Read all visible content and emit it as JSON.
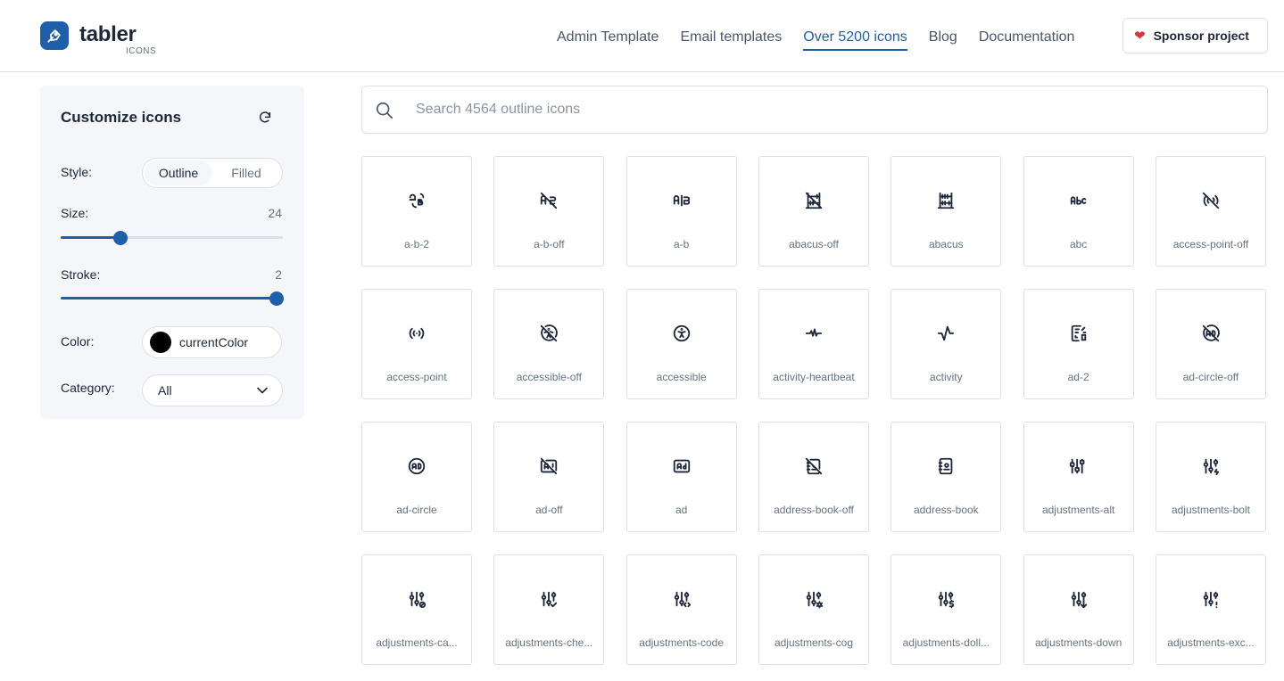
{
  "brand": {
    "name": "tabler",
    "sub": "ICONS"
  },
  "nav": {
    "items": [
      {
        "label": "Admin Template"
      },
      {
        "label": "Email templates"
      },
      {
        "label": "Over 5200 icons"
      },
      {
        "label": "Blog"
      },
      {
        "label": "Documentation"
      }
    ],
    "active_index": 2
  },
  "sponsor": {
    "label": "Sponsor project",
    "icon": "heart-icon",
    "color": "#d63939"
  },
  "customize": {
    "title": "Customize icons",
    "style_label": "Style:",
    "style_options": [
      "Outline",
      "Filled"
    ],
    "style_selected": "Outline",
    "size_label": "Size:",
    "size_value": "24",
    "size_fraction": 0.27,
    "stroke_label": "Stroke:",
    "stroke_value": "2",
    "stroke_fraction": 0.97,
    "color_label": "Color:",
    "color_value": "currentColor",
    "color_swatch": "#000000",
    "category_label": "Category:",
    "category_value": "All"
  },
  "search": {
    "placeholder": "Search 4564 outline icons"
  },
  "theme": {
    "accent": "#1f5ea8",
    "text": "#1d273b",
    "muted": "#667382",
    "border": "#dce1e7"
  },
  "icons": [
    {
      "name": "a-b-2",
      "glyph": "ab2"
    },
    {
      "name": "a-b-off",
      "glyph": "aboff"
    },
    {
      "name": "a-b",
      "glyph": "ab"
    },
    {
      "name": "abacus-off",
      "glyph": "abacusoff"
    },
    {
      "name": "abacus",
      "glyph": "abacus"
    },
    {
      "name": "abc",
      "glyph": "abc"
    },
    {
      "name": "access-point-off",
      "glyph": "apoff"
    },
    {
      "name": "access-point",
      "glyph": "ap"
    },
    {
      "name": "accessible-off",
      "glyph": "accoff"
    },
    {
      "name": "accessible",
      "glyph": "acc"
    },
    {
      "name": "activity-heartbeat",
      "glyph": "heartbeat"
    },
    {
      "name": "activity",
      "glyph": "activity"
    },
    {
      "name": "ad-2",
      "glyph": "ad2"
    },
    {
      "name": "ad-circle-off",
      "glyph": "adcircleoff"
    },
    {
      "name": "ad-circle",
      "glyph": "adcircle"
    },
    {
      "name": "ad-off",
      "glyph": "adoff"
    },
    {
      "name": "ad",
      "glyph": "ad"
    },
    {
      "name": "address-book-off",
      "glyph": "bookoff"
    },
    {
      "name": "address-book",
      "glyph": "book"
    },
    {
      "name": "adjustments-alt",
      "glyph": "adjalt"
    },
    {
      "name": "adjustments-bolt",
      "glyph": "adjbolt"
    },
    {
      "name": "adjustments-ca...",
      "glyph": "adjcancel"
    },
    {
      "name": "adjustments-che...",
      "glyph": "adjcheck"
    },
    {
      "name": "adjustments-code",
      "glyph": "adjcode"
    },
    {
      "name": "adjustments-cog",
      "glyph": "adjcog"
    },
    {
      "name": "adjustments-doll...",
      "glyph": "adjdollar"
    },
    {
      "name": "adjustments-down",
      "glyph": "adjdown"
    },
    {
      "name": "adjustments-exc...",
      "glyph": "adjexc"
    }
  ]
}
